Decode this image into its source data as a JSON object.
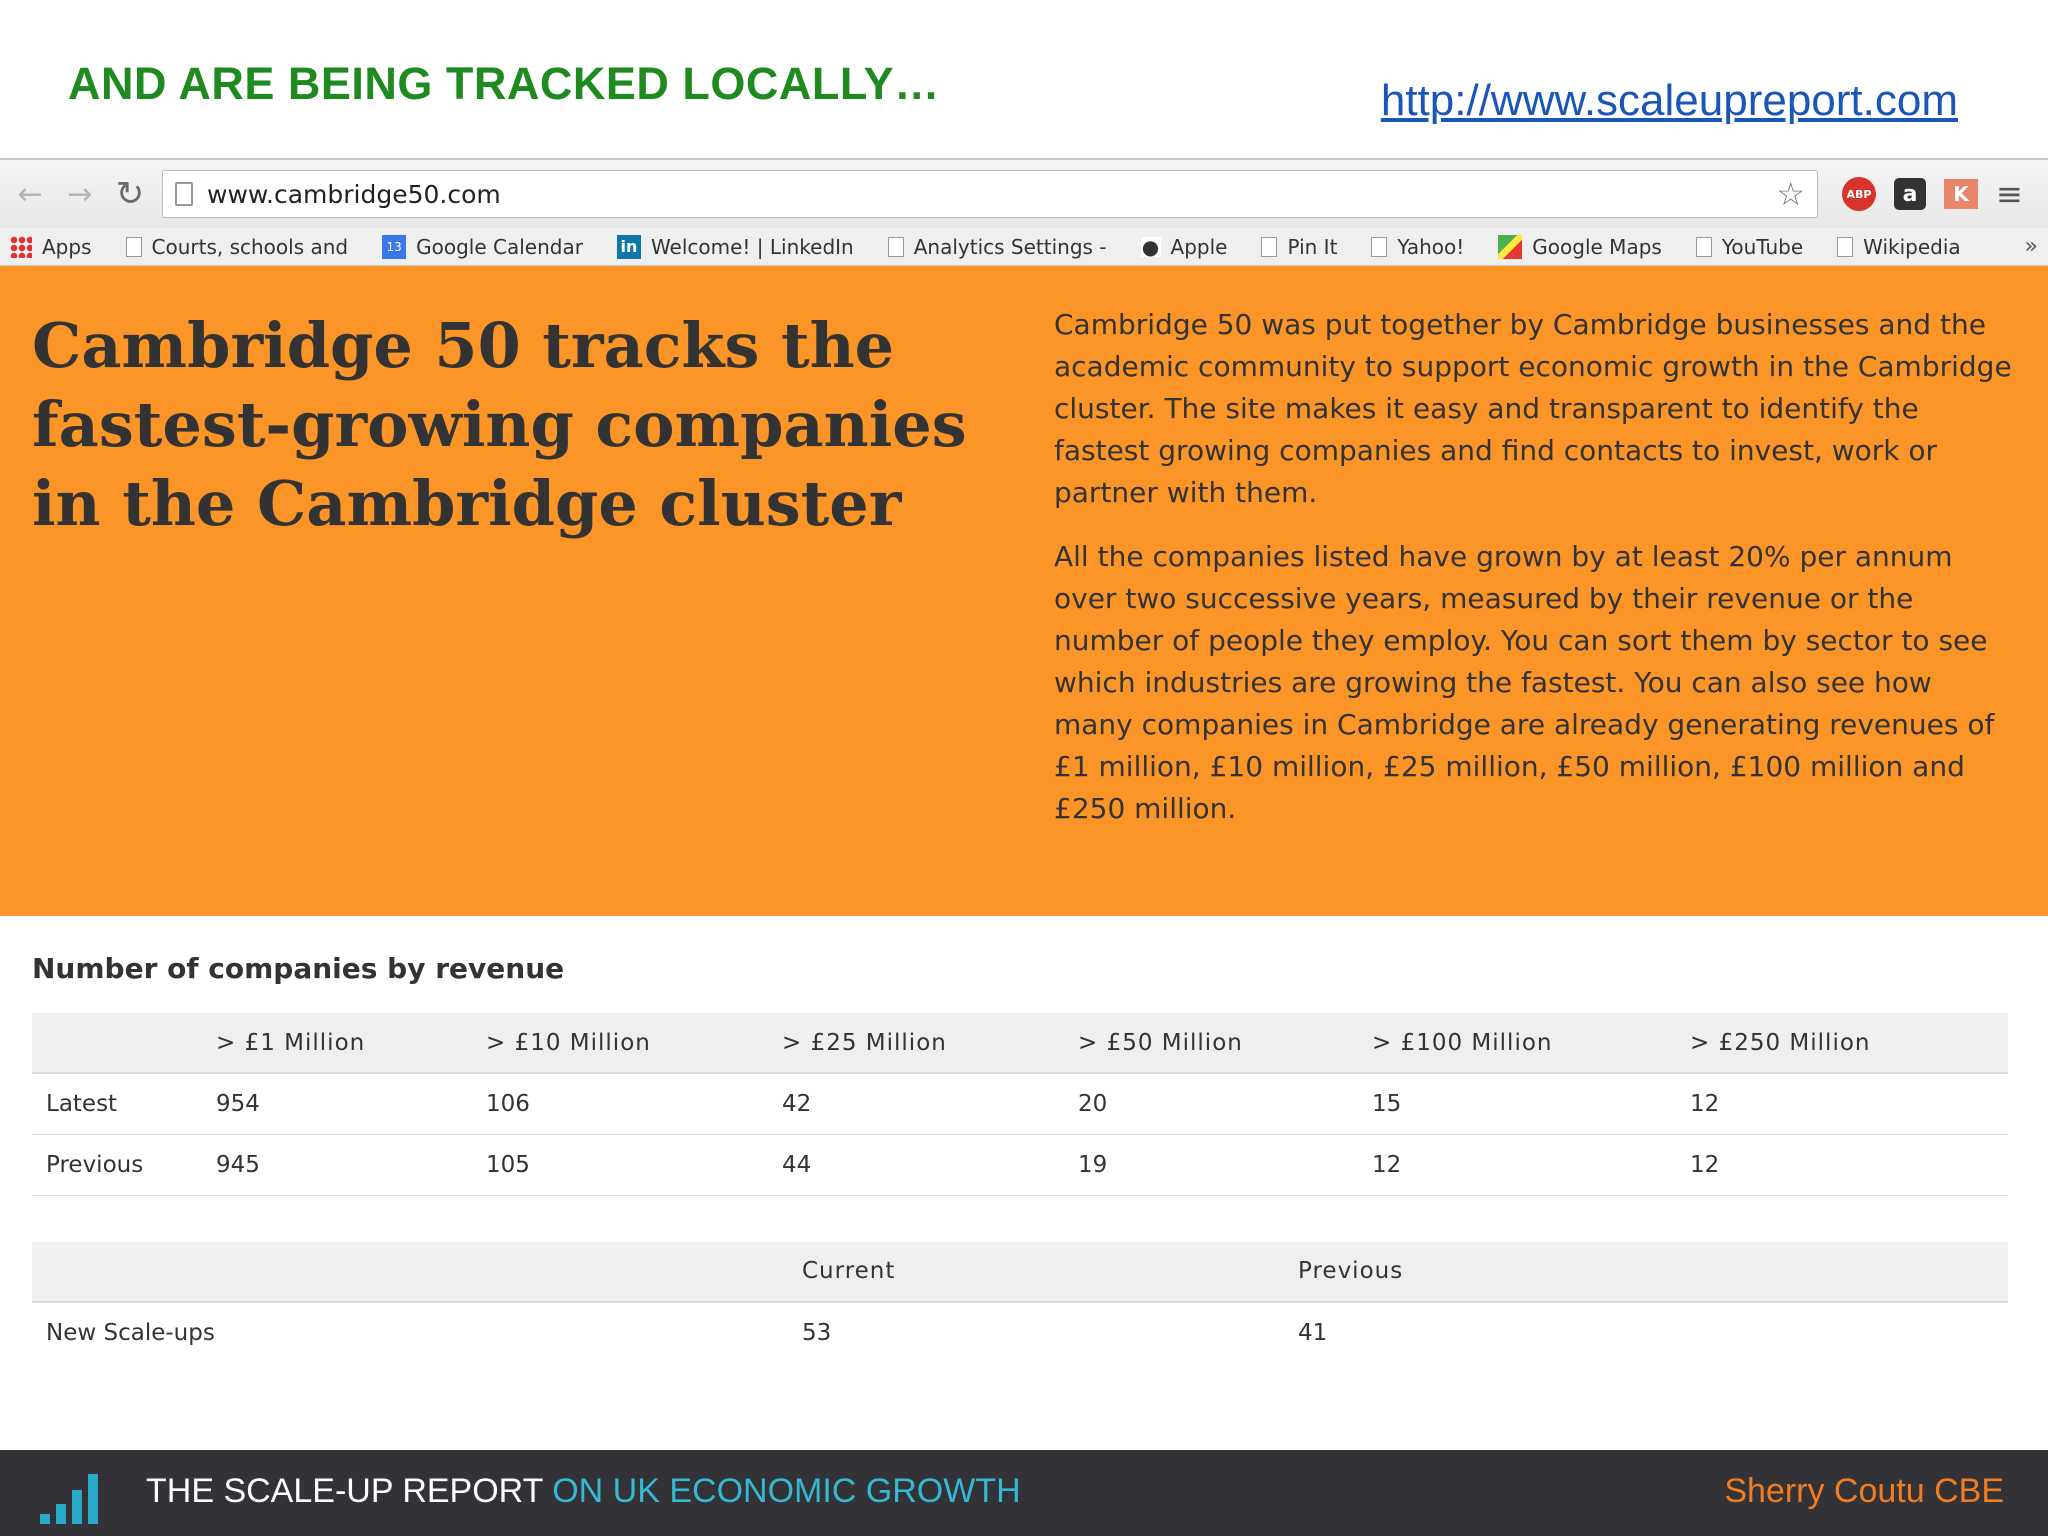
{
  "slide": {
    "title": "AND ARE BEING TRACKED LOCALLY…",
    "link": "http://www.scaleupreport.com"
  },
  "browser": {
    "url": "www.cambridge50.com",
    "icons": [
      "back-icon",
      "forward-icon",
      "reload-icon",
      "star-icon",
      "adblock-icon",
      "amazon-icon",
      "klout-icon",
      "menu-icon"
    ],
    "extensions": {
      "abp": "ABP",
      "amazon": "a",
      "k": "K"
    },
    "bookmarks": [
      {
        "label": "Apps",
        "icon": "apps-icon"
      },
      {
        "label": "Courts, schools and",
        "icon": "page-icon"
      },
      {
        "label": "Google Calendar",
        "icon": "calendar-icon",
        "icon_text": "13"
      },
      {
        "label": "Welcome! | LinkedIn",
        "icon": "linkedin-icon",
        "icon_text": "in"
      },
      {
        "label": "Analytics Settings -",
        "icon": "page-icon"
      },
      {
        "label": "Apple",
        "icon": "apple-icon"
      },
      {
        "label": "Pin It",
        "icon": "page-icon"
      },
      {
        "label": "Yahoo!",
        "icon": "page-icon"
      },
      {
        "label": "Google Maps",
        "icon": "maps-icon"
      },
      {
        "label": "YouTube",
        "icon": "page-icon"
      },
      {
        "label": "Wikipedia",
        "icon": "page-icon"
      }
    ],
    "more": "»"
  },
  "hero": {
    "heading": "Cambridge 50 tracks the fastest-growing companies in the Cambridge cluster",
    "para1": "Cambridge 50 was put together by Cambridge businesses and the academic community to support economic growth in the Cambridge cluster. The site makes it easy and transparent to identify the fastest growing companies and find contacts to invest, work or partner with them.",
    "para2": "All the companies listed have grown by at least 20% per annum over two successive years, measured by their revenue or the number of people they employ. You can sort them by sector to see which industries are growing the fastest. You can also see how many companies in Cambridge are already generating revenues of £1 million, £10 million, £25 million, £50 million, £100 million and £250 million.",
    "background": "#fb9527"
  },
  "revenue_table": {
    "title": "Number of companies by revenue",
    "headers": [
      "",
      "> £1 Million",
      "> £10 Million",
      "> £25 Million",
      "> £50 Million",
      "> £100 Million",
      "> £250 Million"
    ],
    "rows": [
      [
        "Latest",
        "954",
        "106",
        "42",
        "20",
        "15",
        "12"
      ],
      [
        "Previous",
        "945",
        "105",
        "44",
        "19",
        "12",
        "12"
      ]
    ]
  },
  "scaleup_table": {
    "headers": [
      "",
      "Current",
      "Previous"
    ],
    "rows": [
      [
        "New Scale-ups",
        "53",
        "41"
      ]
    ]
  },
  "footer": {
    "title_main": "THE SCALE-UP REPORT",
    "title_accent": "ON UK  ECONOMIC GROWTH",
    "author": "Sherry Coutu CBE",
    "colors": {
      "background": "#333337",
      "accent": "#34b8d4",
      "author": "#f07d22"
    }
  }
}
